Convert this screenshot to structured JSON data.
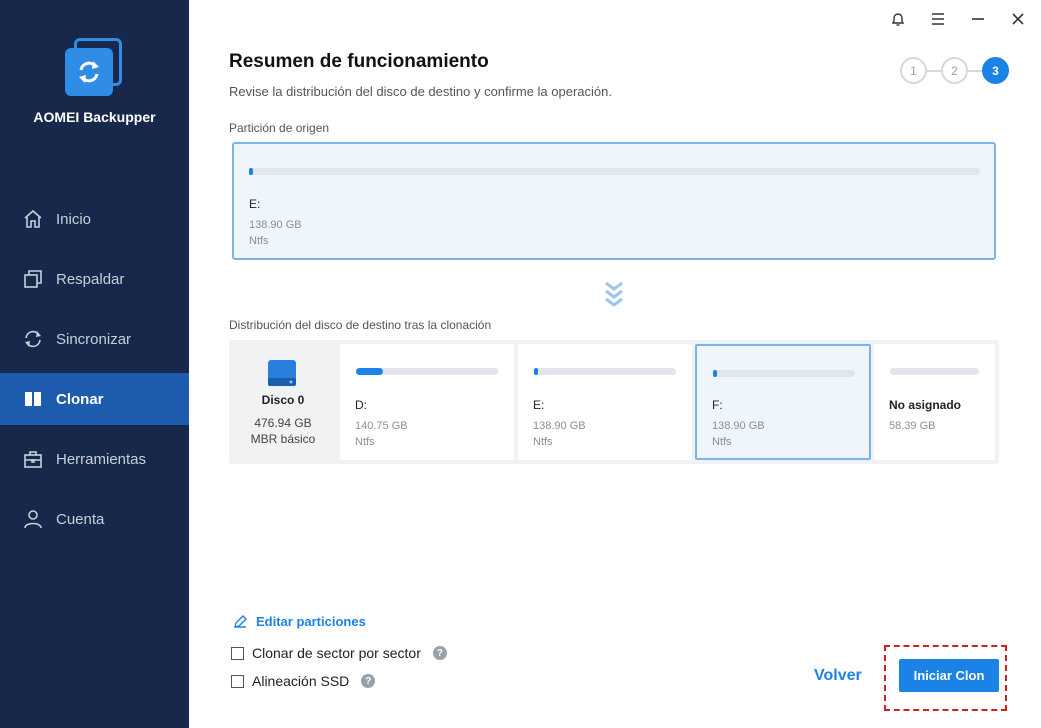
{
  "app": {
    "name": "AOMEI Backupper"
  },
  "sidebar": {
    "items": [
      {
        "label": "Inicio",
        "icon": "home-icon",
        "active": false
      },
      {
        "label": "Respaldar",
        "icon": "backup-icon",
        "active": false
      },
      {
        "label": "Sincronizar",
        "icon": "sync-icon",
        "active": false
      },
      {
        "label": "Clonar",
        "icon": "clone-icon",
        "active": true
      },
      {
        "label": "Herramientas",
        "icon": "toolbox-icon",
        "active": false
      },
      {
        "label": "Cuenta",
        "icon": "user-icon",
        "active": false
      }
    ]
  },
  "header": {
    "title": "Resumen de funcionamiento",
    "subtitle": "Revise la distribución del disco de destino y confirme la operación.",
    "steps": [
      "1",
      "2",
      "3"
    ],
    "current_step": 3
  },
  "source": {
    "label": "Partición de origen",
    "partition": {
      "letter": "E:",
      "size": "138.90 GB",
      "fs": "Ntfs",
      "used_fraction": 0.005
    }
  },
  "destination": {
    "label": "Distribución del disco de destino tras la clonación",
    "disk": {
      "name": "Disco 0",
      "size": "476.94 GB",
      "type": "MBR básico"
    },
    "partitions": [
      {
        "letter": "D:",
        "size": "140.75 GB",
        "fs": "Ntfs",
        "used_fraction": 0.19,
        "selected": false
      },
      {
        "letter": "E:",
        "size": "138.90 GB",
        "fs": "Ntfs",
        "used_fraction": 0.03,
        "selected": false
      },
      {
        "letter": "F:",
        "size": "138.90 GB",
        "fs": "Ntfs",
        "used_fraction": 0.03,
        "selected": true
      },
      {
        "letter": "No asignado",
        "size": "58.39 GB",
        "fs": "",
        "used_fraction": 0,
        "selected": false
      }
    ]
  },
  "options": {
    "edit_partitions": "Editar particiones",
    "sector_by_sector": "Clonar de sector por sector",
    "ssd_alignment": "Alineación SSD"
  },
  "actions": {
    "back": "Volver",
    "start": "Iniciar Clon"
  },
  "colors": {
    "sidebar_bg": "#17284a",
    "accent": "#1c83e6",
    "highlight": "#d41f1f"
  }
}
